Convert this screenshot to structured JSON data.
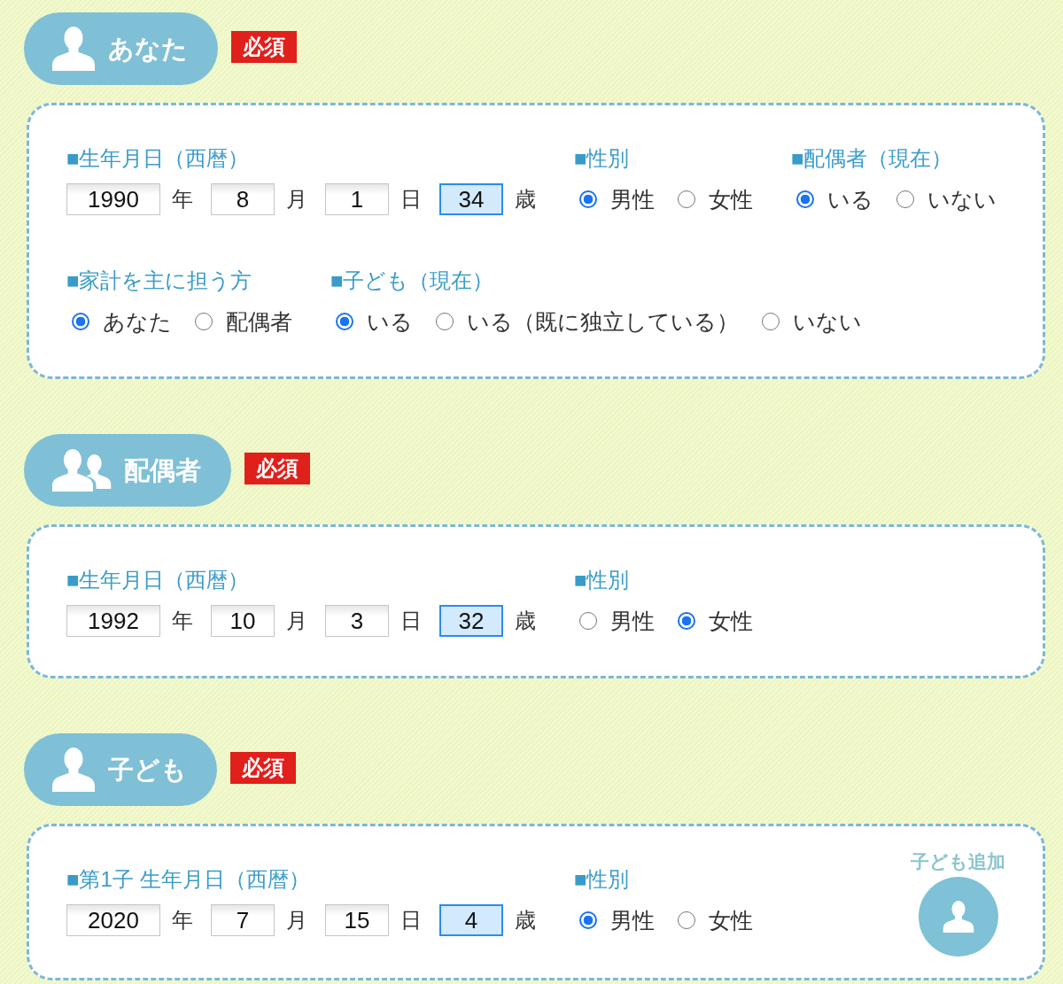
{
  "sections": [
    {
      "kind": "self",
      "title": "あなた",
      "badge": "必須",
      "rows": [
        {
          "groups": [
            {
              "kind": "date",
              "label": "■生年月日（西暦）",
              "fields": [
                {
                  "kind": "year",
                  "value": "1990",
                  "unit": "年"
                },
                {
                  "kind": "month",
                  "value": "8",
                  "unit": "月"
                },
                {
                  "kind": "day",
                  "value": "1",
                  "unit": "日"
                },
                {
                  "kind": "age",
                  "value": "34",
                  "unit": "歳"
                }
              ]
            },
            {
              "kind": "radio",
              "label": "■性別",
              "options": [
                {
                  "label": "男性",
                  "selected": true
                },
                {
                  "label": "女性",
                  "selected": false
                }
              ]
            },
            {
              "kind": "radio",
              "label": "■配偶者（現在）",
              "options": [
                {
                  "label": "いる",
                  "selected": true
                },
                {
                  "label": "いない",
                  "selected": false
                }
              ]
            }
          ]
        },
        {
          "groups": [
            {
              "kind": "radio",
              "label": "■家計を主に担う方",
              "options": [
                {
                  "label": "あなた",
                  "selected": true
                },
                {
                  "label": "配偶者",
                  "selected": false
                }
              ]
            },
            {
              "kind": "radio",
              "label": "■子ども（現在）",
              "options": [
                {
                  "label": "いる",
                  "selected": true
                },
                {
                  "label": "いる（既に独立している）",
                  "selected": false
                },
                {
                  "label": "いない",
                  "selected": false
                }
              ]
            }
          ]
        }
      ]
    },
    {
      "kind": "spouse",
      "title": "配偶者",
      "badge": "必須",
      "rows": [
        {
          "groups": [
            {
              "kind": "date",
              "label": "■生年月日（西暦）",
              "fields": [
                {
                  "kind": "year",
                  "value": "1992",
                  "unit": "年"
                },
                {
                  "kind": "month",
                  "value": "10",
                  "unit": "月"
                },
                {
                  "kind": "day",
                  "value": "3",
                  "unit": "日"
                },
                {
                  "kind": "age",
                  "value": "32",
                  "unit": "歳"
                }
              ]
            },
            {
              "kind": "radio",
              "label": "■性別",
              "options": [
                {
                  "label": "男性",
                  "selected": false
                },
                {
                  "label": "女性",
                  "selected": true
                }
              ]
            }
          ]
        }
      ]
    },
    {
      "kind": "child",
      "title": "子ども",
      "badge": "必須",
      "rows": [
        {
          "groups": [
            {
              "kind": "date",
              "label": "■第1子 生年月日（西暦）",
              "fields": [
                {
                  "kind": "year",
                  "value": "2020",
                  "unit": "年"
                },
                {
                  "kind": "month",
                  "value": "7",
                  "unit": "月"
                },
                {
                  "kind": "day",
                  "value": "15",
                  "unit": "日"
                },
                {
                  "kind": "age",
                  "value": "4",
                  "unit": "歳"
                }
              ]
            },
            {
              "kind": "radio",
              "label": "■性別",
              "options": [
                {
                  "label": "男性",
                  "selected": true
                },
                {
                  "label": "女性",
                  "selected": false
                }
              ]
            }
          ]
        }
      ],
      "add_button": {
        "label": "子ども追加"
      }
    }
  ]
}
